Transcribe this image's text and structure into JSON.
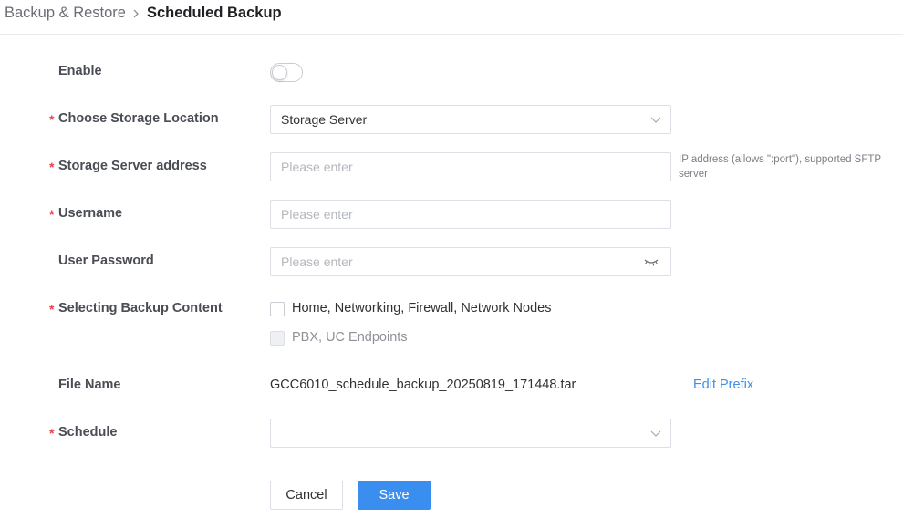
{
  "breadcrumb": {
    "parent": "Backup & Restore",
    "current": "Scheduled Backup"
  },
  "form": {
    "enable": {
      "label": "Enable",
      "enabled": false
    },
    "storage_location": {
      "label": "Choose Storage Location",
      "value": "Storage Server",
      "required": true
    },
    "server_address": {
      "label": "Storage Server address",
      "placeholder": "Please enter",
      "hint": "IP address (allows \":port\"), supported SFTP server",
      "required": true
    },
    "username": {
      "label": "Username",
      "placeholder": "Please enter",
      "required": true
    },
    "password": {
      "label": "User Password",
      "placeholder": "Please enter",
      "icon": "eye-closed-icon"
    },
    "backup_content": {
      "label": "Selecting Backup Content",
      "required": true,
      "options": [
        {
          "label": "Home, Networking, Firewall, Network Nodes",
          "checked": false,
          "disabled": false
        },
        {
          "label": "PBX, UC Endpoints",
          "checked": false,
          "disabled": true
        }
      ]
    },
    "file_name": {
      "label": "File Name",
      "value": "GCC6010_schedule_backup_20250819_171448.tar",
      "edit_link": "Edit Prefix"
    },
    "schedule": {
      "label": "Schedule",
      "value": "",
      "required": true
    }
  },
  "buttons": {
    "cancel": "Cancel",
    "save": "Save"
  },
  "colors": {
    "accent": "#3a8ef0",
    "required": "#f0404a",
    "link": "#3c8fe8"
  }
}
